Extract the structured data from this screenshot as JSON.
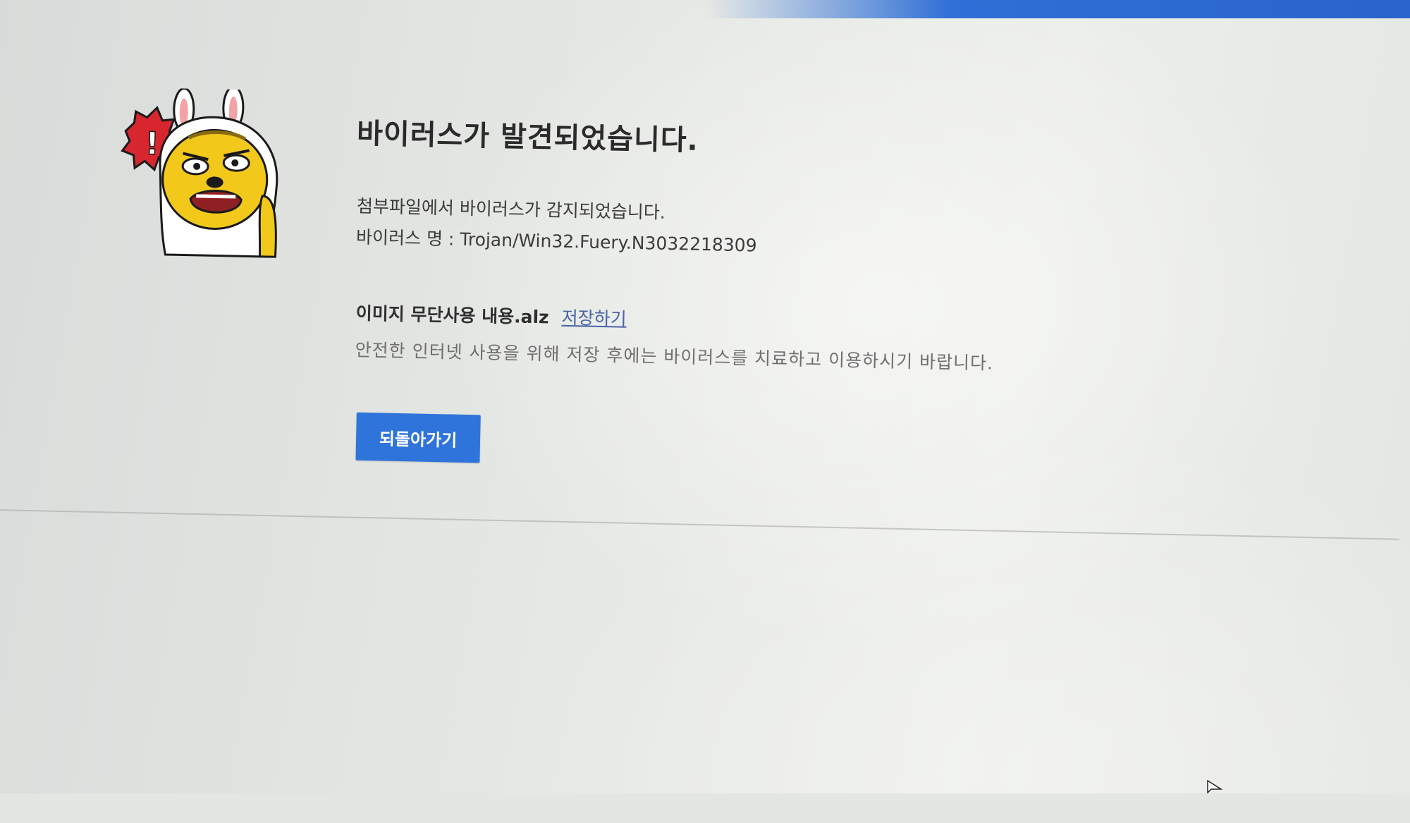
{
  "page": {
    "title": "바이러스가 발견되었습니다.",
    "description": "첨부파일에서 바이러스가 감지되었습니다.",
    "virus_name_label": "바이러스 명 : ",
    "virus_name": "Trojan/Win32.Fuery.N3032218309",
    "file_name": "이미지 무단사용 내용.alz",
    "save_link": "저장하기",
    "advice": "안전한 인터넷 사용을 위해 저장 후에는 바이러스를 치료하고 이용하시기 바랍니다.",
    "back_button": "되돌아가기",
    "mascot_badge": "!"
  },
  "colors": {
    "accent": "#2f74da",
    "top_bar": "#2f6fd6",
    "link": "#4a62a8",
    "mascot_yellow": "#f2c81b",
    "badge_red": "#d8262e"
  },
  "icons": {
    "mascot": "alarmed-character-illustration",
    "cursor": "mouse-pointer-icon"
  }
}
